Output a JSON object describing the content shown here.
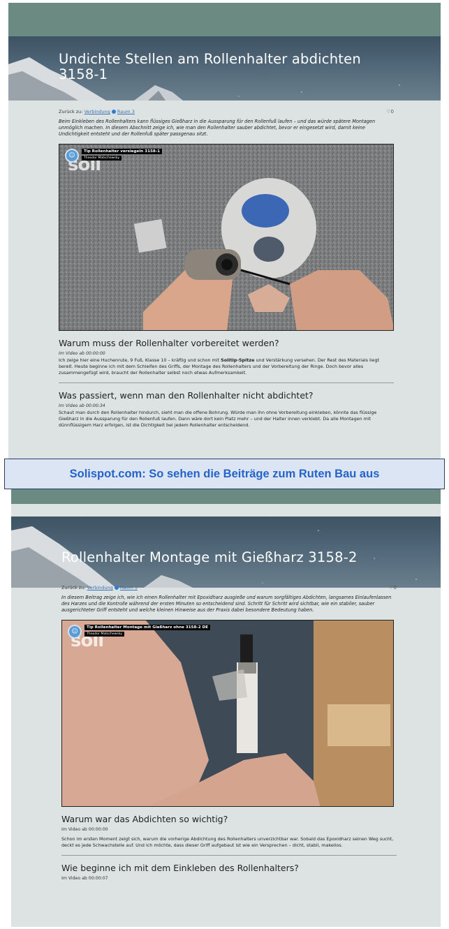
{
  "banner": "Solispot.com: So sehen die Beiträge zum Ruten Bau aus",
  "colors": {
    "topbar": "#6b8a82",
    "page_bg": "#dde3e2",
    "banner_text": "#2563c9",
    "banner_bg": "#dbe5f3",
    "link": "#3b6fb0"
  },
  "post1": {
    "title": "Undichte Stellen am Rollenhalter abdichten 3158-1",
    "back_label": "Zurück zu:",
    "back_link_a": "Verbindung",
    "back_link_b": "Raum 3",
    "likes": "♡0",
    "intro": "Beim Einkleben des Rollenhalters kann flüssiges Gießharz in die Aussparung für den Rollenfuß laufen – und das würde spätere Montagen unmöglich machen. In diesem Abschnitt zeige ich, wie man den Rollenhalter sauber abdichtet, bevor er eingesetzt wird, damit keine Undichtigkeit entsteht und der Rollenfuß später passgenau sitzt.",
    "video_title": "Tip Rollenhalter versiegeln 3158-1",
    "video_author": "Theodor Matschewsky",
    "watermark": "soli",
    "section1_heading": "Warum muss der Rollenhalter vorbereitet werden?",
    "section1_time": "Im Video ab 00:00:00",
    "section1_text_a": "Ich zeige hier eine Huchenrute, 9 Fuß, Klasse 10 – kräftig und schon mit ",
    "section1_text_bold": "Solitip-Spitze",
    "section1_text_b": " und Verstärkung versehen. Der Rest des Materials liegt bereit. Heute beginne ich mit dem Schleifen des Griffs, der Montage des Rollenhalters und der Vorbereitung der Ringe. Doch bevor alles zusammengefügt wird, braucht der Rollenhalter selbst noch etwas Aufmerksamkeit.",
    "section2_heading": "Was passiert, wenn man den Rollenhalter nicht abdichtet?",
    "section2_time": "Im Video ab 00:00:34",
    "section2_text": "Schaut man durch den Rollenhalter hindurch, sieht man die offene Bohrung. Würde man ihn ohne Vorbereitung einkleben, könnte das flüssige Gießharz in die Aussparung für den Rollenfuß laufen. Dann wäre dort kein Platz mehr – und der Halter innen verklebt. Da alle Montagen mit dünnflüssigem Harz erfolgen, ist die Dichtigkeit bei jedem Rollenhalter entscheidend."
  },
  "post2": {
    "title": "Rollenhalter Montage mit Gießharz 3158-2",
    "back_label": "Zurück zu:",
    "back_link_a": "Verbindung",
    "back_link_b": "Raum 3",
    "likes": "♡0",
    "intro": "In diesem Beitrag zeige ich, wie ich einen Rollenhalter mit Epoxidharz ausgieße und warum sorgfältiges Abdichten, langsames Einlaufenlassen des Harzes und die Kontrolle während der ersten Minuten so entscheidend sind. Schritt für Schritt wird sichtbar, wie ein stabiler, sauber ausgerichteter Griff entsteht und welche kleinen Hinweise aus der Praxis dabei besondere Bedeutung haben.",
    "video_title": "Tip Rollenhalter Montage mit Gießharz ohne 3158-2 DE",
    "video_author": "Theodor Matschewsky",
    "watermark": "soli",
    "section1_heading": "Warum war das Abdichten so wichtig?",
    "section1_time": "Im Video ab 00:00:00",
    "section1_text": "Schon im ersten Moment zeigt sich, warum die vorherige Abdichtung des Rollenhalters unverzichtbar war. Sobald das Epoxidharz seinen Weg sucht, deckt es jede Schwachstelle auf. Und ich möchte, dass dieser Griff aufgebaut ist wie ein Versprechen – dicht, stabil, makellos.",
    "section2_heading": "Wie beginne ich mit dem Einkleben des Rollenhalters?",
    "section2_time": "Im Video ab 00:00:07"
  }
}
